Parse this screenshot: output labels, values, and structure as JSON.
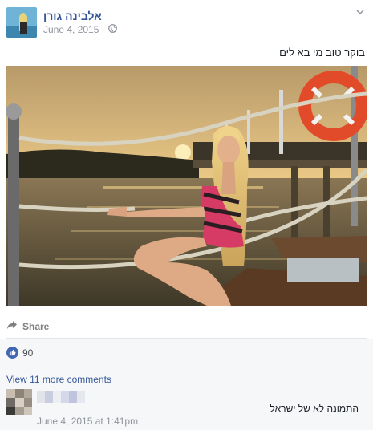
{
  "post": {
    "author": "אלבינה גורן",
    "date": "June 4, 2015",
    "audience_icon": "globe-icon",
    "text": "בוקר טוב מי בא לים",
    "photo_alt": "Woman in pink dress posing on a pier at sunset"
  },
  "actions": {
    "share_label": "Share",
    "share_icon": "share-arrow-icon"
  },
  "reactions": {
    "like_icon": "thumbs-up-icon",
    "count": "90"
  },
  "comments": {
    "view_more": "View 11 more comments",
    "items": [
      {
        "text": "התמונה לא של ישראל",
        "timestamp": "June 4, 2015 at 1:41pm"
      }
    ]
  },
  "colors": {
    "link": "#365899",
    "meta": "#90949c",
    "like_blue": "#4267b2",
    "feedback_bg": "#f6f7f9"
  }
}
